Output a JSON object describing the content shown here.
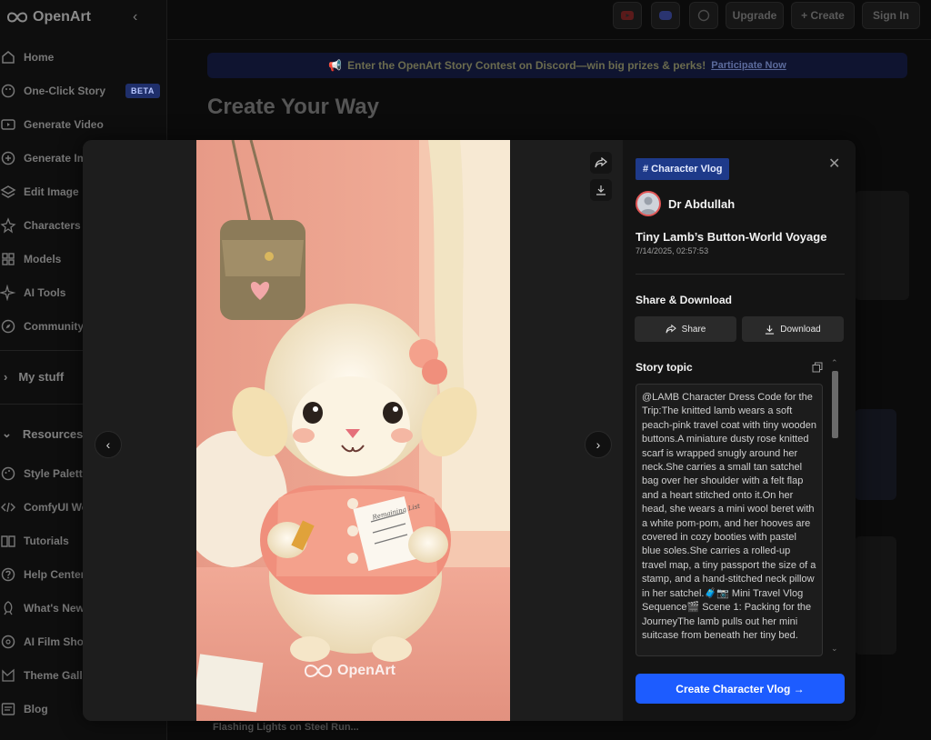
{
  "app": {
    "logo_text": "OpenArt"
  },
  "sidebar": {
    "items": [
      {
        "label": "Home"
      },
      {
        "label": "One-Click Story",
        "badge": "BETA"
      },
      {
        "label": "Generate Video"
      },
      {
        "label": "Generate Im"
      },
      {
        "label": "Edit Image"
      },
      {
        "label": "Characters"
      },
      {
        "label": "Models"
      },
      {
        "label": "AI Tools"
      },
      {
        "label": "Community"
      }
    ],
    "my_stuff": "My stuff",
    "resources": "Resources",
    "resource_items": [
      {
        "label": "Style Palette"
      },
      {
        "label": "ComfyUI Wo"
      },
      {
        "label": "Tutorials"
      },
      {
        "label": "Help Center"
      },
      {
        "label": "What's New"
      },
      {
        "label": "AI Film Show"
      },
      {
        "label": "Theme Galle"
      },
      {
        "label": "Blog"
      }
    ]
  },
  "topbar": {
    "upgrade": "Upgrade",
    "create": "+ Create",
    "sign_in": "Sign In"
  },
  "banner": {
    "text": "Enter the OpenArt Story Contest on Discord—win big prizes & perks!",
    "link": "Participate Now"
  },
  "page": {
    "heading": "Create Your Way",
    "caption": "Flashing Lights on Steel Run..."
  },
  "modal": {
    "watermark": "OpenArt",
    "tag": "# Character Vlog",
    "author": "Dr Abdullah",
    "title": "Tiny Lamb’s Button-World Voyage",
    "date": "7/14/2025, 02:57:53",
    "share_heading": "Share & Download",
    "share_label": "Share",
    "download_label": "Download",
    "topic_heading": "Story topic",
    "topic_text": "@LAMB Character Dress Code for the Trip:The knitted lamb wears a soft peach-pink travel coat with tiny wooden buttons.A miniature dusty rose knitted scarf is wrapped snugly around her neck.She carries a small tan satchel bag over her shoulder with a felt flap and a heart stitched onto it.On her head, she wears a mini wool beret with a white pom-pom, and her hooves are covered in cozy booties with pastel blue soles.She carries a rolled-up travel map, a tiny passport the size of a stamp, and a hand-stitched neck pillow in her satchel.🧳📷 Mini Travel Vlog Sequence🎬 Scene 1: Packing for the JourneyThe lamb pulls out her mini suitcase from beneath her tiny bed.",
    "cta": "Create Character Vlog →",
    "note_title": "Remaining List"
  },
  "colors": {
    "accent": "#1d5cff",
    "tag_bg": "#1e3a8a",
    "beta_bg": "#1f2f6b"
  }
}
